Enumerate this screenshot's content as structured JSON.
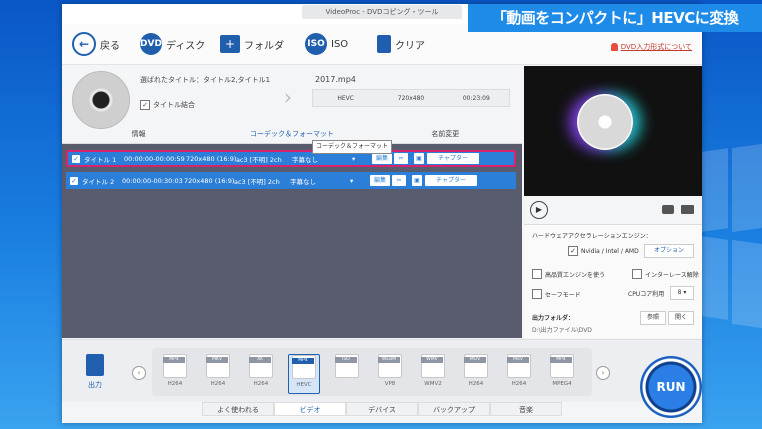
{
  "window": {
    "title": "VideoProc - DVDコピング・ツール"
  },
  "banner": {
    "text": "「動画をコンパクトに」HEVCに変換"
  },
  "toolbar": {
    "back": "戻る",
    "disc": "ディスク",
    "folder": "フォルダ",
    "iso": "ISO",
    "clear": "クリア",
    "notice": "DVD入力形式について"
  },
  "source": {
    "titles_selected": "選ばれたタイトル：タイトル2,タイトル1",
    "merge_titles": "タイトル結合",
    "output_file": "2017.mp4",
    "codec": "HEVC",
    "resolution": "720x480",
    "duration": "00:23:09"
  },
  "tabs": {
    "info": "情報",
    "codec": "コーデック＆フォーマット",
    "rename": "名前変更"
  },
  "tooltip": "コーデック＆フォーマット",
  "titles": [
    {
      "name": "タイトル 1",
      "time": "00:00:00-00:00:59",
      "res": "720x480 (16:9)",
      "audio": "ac3 [不明] 2ch",
      "subtitle": "字幕なし",
      "edit": "編集",
      "chapter": "チャプター"
    },
    {
      "name": "タイトル 2",
      "time": "00:00:00-00:30:03",
      "res": "720x480 (16:9)",
      "audio": "ac3 [不明] 2ch",
      "subtitle": "字幕なし",
      "edit": "編集",
      "chapter": "チャプター"
    }
  ],
  "settings": {
    "hw_accel": "ハードウェアアクセラレーションエンジン：",
    "gpu": "Nvidia / Intel / AMD",
    "option": "オプション",
    "high_quality": "高品質エンジンを使う",
    "deinterlace": "インターレース解除",
    "safe_mode": "セーフモード",
    "cpu_usage": "CPUコア利用",
    "cpu_value": "8",
    "output_folder_label": "出力フォルダ：",
    "output_folder_value": "D:\\出力ファイル\\DVD",
    "browse": "参照",
    "open": "開く"
  },
  "output_label": "出力",
  "formats": [
    {
      "tag": "MP4",
      "label": "H264"
    },
    {
      "tag": "MKV",
      "label": "H264"
    },
    {
      "tag": "4K",
      "label": "H264"
    },
    {
      "tag": "MP4",
      "label": "HEVC",
      "selected": true
    },
    {
      "tag": "ISO",
      "label": ""
    },
    {
      "tag": "WEBM",
      "label": "VP8"
    },
    {
      "tag": "WMV",
      "label": "WMV2"
    },
    {
      "tag": "MOV",
      "label": "H264"
    },
    {
      "tag": "M4V",
      "label": "H264"
    },
    {
      "tag": "MP4",
      "label": "MPEG4"
    }
  ],
  "bottom_tabs": [
    "よく使われる",
    "ビデオ",
    "デバイス",
    "バックアップ",
    "音楽"
  ],
  "run": "RUN"
}
